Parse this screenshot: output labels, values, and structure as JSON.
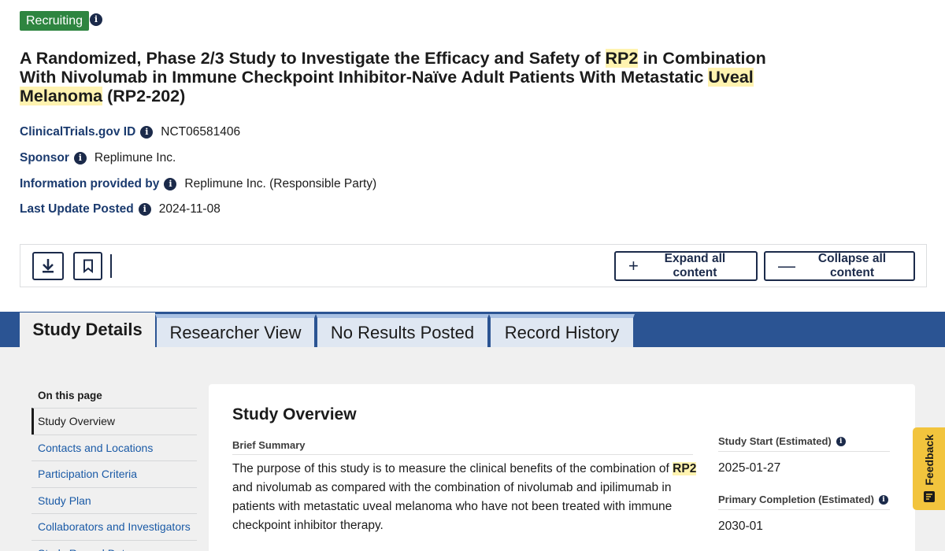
{
  "status": {
    "badge": "Recruiting"
  },
  "title": {
    "part1": "A Randomized, Phase 2/3 Study to Investigate the Efficacy and Safety of ",
    "hl1": "RP2",
    "part2": " in Combination With Nivolumab in Immune Checkpoint Inhibitor-Naïve Adult Patients With Metastatic ",
    "hl2": "Uveal Melanoma",
    "part3": " (RP2-202)"
  },
  "meta": [
    {
      "label": "ClinicalTrials.gov ID",
      "value": "NCT06581406"
    },
    {
      "label": "Sponsor",
      "value": "Replimune Inc."
    },
    {
      "label": "Information provided by",
      "value": "Replimune Inc. (Responsible Party)"
    },
    {
      "label": "Last Update Posted",
      "value": "2024-11-08"
    }
  ],
  "toolbar": {
    "expand_glyph": "+",
    "expand_label": "Expand all content",
    "collapse_glyph": "—",
    "collapse_label": "Collapse all content"
  },
  "tabs": [
    "Study Details",
    "Researcher View",
    "No Results Posted",
    "Record History"
  ],
  "sidenav": {
    "heading": "On this page",
    "items": [
      "Study Overview",
      "Contacts and Locations",
      "Participation Criteria",
      "Study Plan",
      "Collaborators and Investigators",
      "Study Record Dates"
    ]
  },
  "overview": {
    "title": "Study Overview",
    "summary_label": "Brief Summary",
    "summary_part1": "The purpose of this study is to measure the clinical benefits of the combination of ",
    "summary_hl": "RP2",
    "summary_part2": " and nivolumab as compared with the combination of nivolumab and ipilimumab in patients with metastatic uveal melanoma who have not been treated with immune checkpoint inhibitor therapy."
  },
  "dates": {
    "start_label": "Study Start (Estimated)",
    "start_value": "2025-01-27",
    "primary_label": "Primary Completion (Estimated)",
    "primary_value": "2030-01"
  },
  "feedback": {
    "label": "Feedback"
  },
  "icons": {
    "info": "i"
  },
  "colors": {
    "recruiting": "#2e8540",
    "tabbar": "#2b5493",
    "highlight": "#fff3b0",
    "feedback": "#f2c43d"
  }
}
